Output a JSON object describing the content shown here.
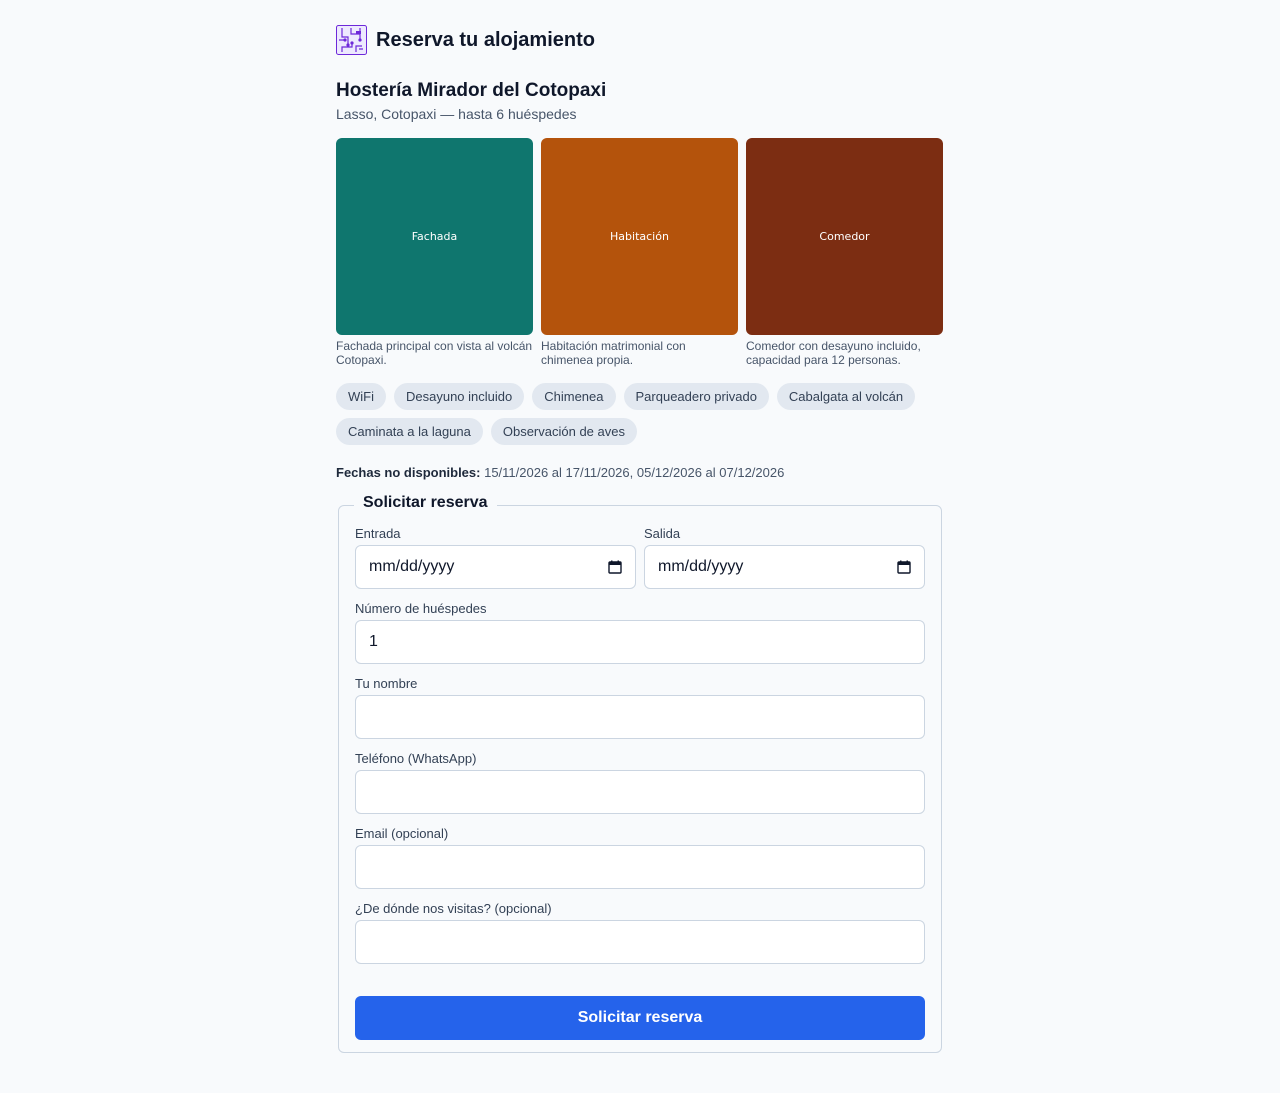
{
  "app": {
    "title": "Reserva tu alojamiento",
    "logo_icon": "circuit-board-icon"
  },
  "property": {
    "name": "Hostería Mirador del Cotopaxi",
    "subtitle": "Lasso, Cotopaxi — hasta 6 huéspedes"
  },
  "gallery": [
    {
      "label": "Fachada",
      "caption": "Fachada principal con vista al volcán Cotopaxi.",
      "color": "#0f766e"
    },
    {
      "label": "Habitación",
      "caption": "Habitación matrimonial con chimenea propia.",
      "color": "#b4530c"
    },
    {
      "label": "Comedor",
      "caption": "Comedor con desayuno incluido, capacidad para 12 personas.",
      "color": "#7c2d12"
    }
  ],
  "amenities": [
    "WiFi",
    "Desayuno incluido",
    "Chimenea",
    "Parqueadero privado",
    "Cabalgata al volcán",
    "Caminata a la laguna",
    "Observación de aves"
  ],
  "unavailable": {
    "label": "Fechas no disponibles:",
    "dates": "15/11/2026 al 17/11/2026, 05/12/2026 al 07/12/2026"
  },
  "form": {
    "legend": "Solicitar reserva",
    "checkin": {
      "label": "Entrada",
      "value": "mm/dd/yyyy"
    },
    "checkout": {
      "label": "Salida",
      "value": "mm/dd/yyyy"
    },
    "guests": {
      "label": "Número de huéspedes",
      "value": "1"
    },
    "name": {
      "label": "Tu nombre",
      "value": ""
    },
    "phone": {
      "label": "Teléfono (WhatsApp)",
      "value": ""
    },
    "email": {
      "label": "Email (opcional)",
      "value": ""
    },
    "origin": {
      "label": "¿De dónde nos visitas? (opcional)",
      "value": ""
    },
    "submit_label": "Solicitar reserva"
  },
  "colors": {
    "accent": "#2563eb",
    "chip_bg": "#e2e8f0",
    "logo": "#8b5cf6"
  }
}
